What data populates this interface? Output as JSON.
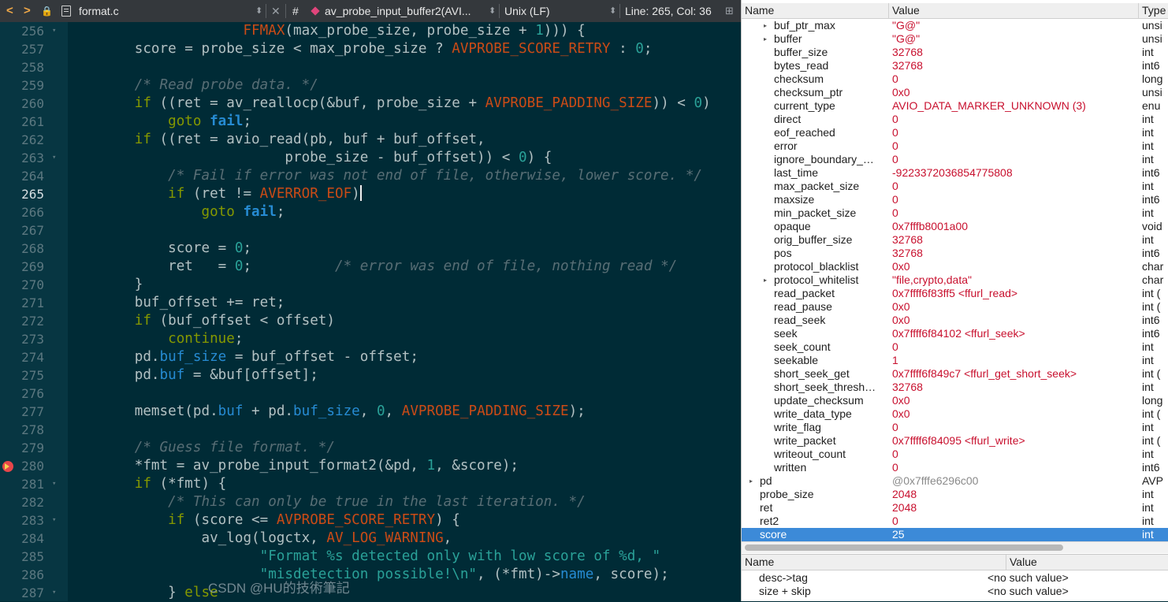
{
  "toolbar": {
    "back": "<",
    "forward": ">",
    "file_name": "format.c",
    "close": "✕",
    "hash": "#",
    "function": "av_probe_input_buffer2(AVI...",
    "line_ending": "Unix (LF)",
    "position": "Line: 265, Col: 36"
  },
  "editor": {
    "current_line": 265,
    "breakpoint_line": 280,
    "lines": [
      {
        "n": 256,
        "fold": true,
        "t": [
          [
            "                     ",
            ""
          ],
          [
            "FFMAX",
            "mac"
          ],
          [
            "(max_probe_size, probe_size + ",
            ""
          ],
          [
            "1",
            "num"
          ],
          [
            "))) {",
            ""
          ]
        ]
      },
      {
        "n": 257,
        "t": [
          [
            "        score = probe_size < max_probe_size ? ",
            ""
          ],
          [
            "AVPROBE_SCORE_RETRY",
            "mac"
          ],
          [
            " : ",
            ""
          ],
          [
            "0",
            "num"
          ],
          [
            ";",
            ""
          ]
        ]
      },
      {
        "n": 258,
        "t": []
      },
      {
        "n": 259,
        "t": [
          [
            "        ",
            ""
          ],
          [
            "/* Read probe data. */",
            "cmt"
          ]
        ]
      },
      {
        "n": 260,
        "t": [
          [
            "        ",
            ""
          ],
          [
            "if",
            "kw"
          ],
          [
            " ((ret = av_reallocp(&buf, probe_size + ",
            ""
          ],
          [
            "AVPROBE_PADDING_SIZE",
            "mac"
          ],
          [
            ")) < ",
            ""
          ],
          [
            "0",
            "num"
          ],
          [
            ")",
            ""
          ]
        ]
      },
      {
        "n": 261,
        "t": [
          [
            "            ",
            ""
          ],
          [
            "goto",
            "kw"
          ],
          [
            " ",
            ""
          ],
          [
            "fail",
            "kwb"
          ],
          [
            ";",
            ""
          ]
        ]
      },
      {
        "n": 262,
        "t": [
          [
            "        ",
            ""
          ],
          [
            "if",
            "kw"
          ],
          [
            " ((ret = avio_read(pb, buf + buf_offset,",
            ""
          ]
        ]
      },
      {
        "n": 263,
        "fold": true,
        "t": [
          [
            "                          probe_size - buf_offset)) < ",
            ""
          ],
          [
            "0",
            "num"
          ],
          [
            ") {",
            ""
          ]
        ]
      },
      {
        "n": 264,
        "t": [
          [
            "            ",
            ""
          ],
          [
            "/* Fail if error was not end of file, otherwise, lower score. */",
            "cmt"
          ]
        ]
      },
      {
        "n": 265,
        "caret": true,
        "t": [
          [
            "            ",
            ""
          ],
          [
            "if",
            "kw"
          ],
          [
            " (ret != ",
            ""
          ],
          [
            "AVERROR_EOF",
            "mac"
          ],
          [
            ")",
            ""
          ]
        ]
      },
      {
        "n": 266,
        "t": [
          [
            "                ",
            ""
          ],
          [
            "goto",
            "kw"
          ],
          [
            " ",
            ""
          ],
          [
            "fail",
            "kwb"
          ],
          [
            ";",
            ""
          ]
        ]
      },
      {
        "n": 267,
        "t": []
      },
      {
        "n": 268,
        "t": [
          [
            "            score = ",
            ""
          ],
          [
            "0",
            "num"
          ],
          [
            ";",
            ""
          ]
        ]
      },
      {
        "n": 269,
        "t": [
          [
            "            ret   = ",
            ""
          ],
          [
            "0",
            "num"
          ],
          [
            ";          ",
            ""
          ],
          [
            "/* error was end of file, nothing read */",
            "cmt"
          ]
        ]
      },
      {
        "n": 270,
        "t": [
          [
            "        }",
            ""
          ]
        ]
      },
      {
        "n": 271,
        "t": [
          [
            "        buf_offset += ret;",
            ""
          ]
        ]
      },
      {
        "n": 272,
        "t": [
          [
            "        ",
            ""
          ],
          [
            "if",
            "kw"
          ],
          [
            " (buf_offset < offset)",
            ""
          ]
        ]
      },
      {
        "n": 273,
        "t": [
          [
            "            ",
            ""
          ],
          [
            "continue",
            "kw"
          ],
          [
            ";",
            ""
          ]
        ]
      },
      {
        "n": 274,
        "t": [
          [
            "        pd.",
            ""
          ],
          [
            "buf_size",
            "fld"
          ],
          [
            " = buf_offset - offset;",
            ""
          ]
        ]
      },
      {
        "n": 275,
        "t": [
          [
            "        pd.",
            ""
          ],
          [
            "buf",
            "fld"
          ],
          [
            " = &buf[offset];",
            ""
          ]
        ]
      },
      {
        "n": 276,
        "t": []
      },
      {
        "n": 277,
        "t": [
          [
            "        memset(pd.",
            ""
          ],
          [
            "buf",
            "fld"
          ],
          [
            " + pd.",
            ""
          ],
          [
            "buf_size",
            "fld"
          ],
          [
            ", ",
            ""
          ],
          [
            "0",
            "num"
          ],
          [
            ", ",
            ""
          ],
          [
            "AVPROBE_PADDING_SIZE",
            "mac"
          ],
          [
            ");",
            ""
          ]
        ]
      },
      {
        "n": 278,
        "t": []
      },
      {
        "n": 279,
        "t": [
          [
            "        ",
            ""
          ],
          [
            "/* Guess file format. */",
            "cmt"
          ]
        ]
      },
      {
        "n": 280,
        "t": [
          [
            "        *fmt = av_probe_input_format2(&pd, ",
            ""
          ],
          [
            "1",
            "num"
          ],
          [
            ", &score);",
            ""
          ]
        ]
      },
      {
        "n": 281,
        "fold": true,
        "t": [
          [
            "        ",
            ""
          ],
          [
            "if",
            "kw"
          ],
          [
            " (*fmt) {",
            ""
          ]
        ]
      },
      {
        "n": 282,
        "t": [
          [
            "            ",
            ""
          ],
          [
            "/* This can only be true in the last iteration. */",
            "cmt"
          ]
        ]
      },
      {
        "n": 283,
        "fold": true,
        "t": [
          [
            "            ",
            ""
          ],
          [
            "if",
            "kw"
          ],
          [
            " (score <= ",
            ""
          ],
          [
            "AVPROBE_SCORE_RETRY",
            "mac"
          ],
          [
            ") {",
            ""
          ]
        ]
      },
      {
        "n": 284,
        "t": [
          [
            "                av_log(logctx, ",
            ""
          ],
          [
            "AV_LOG_WARNING",
            "mac"
          ],
          [
            ",",
            ""
          ]
        ]
      },
      {
        "n": 285,
        "t": [
          [
            "                       ",
            ""
          ],
          [
            "\"Format %s detected only with low score of %d, \"",
            "str"
          ]
        ]
      },
      {
        "n": 286,
        "t": [
          [
            "                       ",
            ""
          ],
          [
            "\"misdetection possible!\\n\"",
            "str"
          ],
          [
            ", (*fmt)->",
            ""
          ],
          [
            "name",
            "fld"
          ],
          [
            ", score);",
            ""
          ]
        ]
      },
      {
        "n": 287,
        "fold": true,
        "t": [
          [
            "            } ",
            ""
          ],
          [
            "else",
            "kw"
          ]
        ]
      }
    ]
  },
  "locals": {
    "headers": {
      "name": "Name",
      "value": "Value",
      "type": "Type"
    },
    "rows": [
      {
        "indent": 1,
        "exp": true,
        "name": "buf_ptr_max",
        "value": "\"G@\"",
        "type": "unsi"
      },
      {
        "indent": 1,
        "exp": true,
        "name": "buffer",
        "value": "\"G@\"",
        "type": "unsi"
      },
      {
        "indent": 1,
        "name": "buffer_size",
        "value": "32768",
        "type": "int"
      },
      {
        "indent": 1,
        "name": "bytes_read",
        "value": "32768",
        "type": "int6"
      },
      {
        "indent": 1,
        "name": "checksum",
        "value": "0",
        "type": "long"
      },
      {
        "indent": 1,
        "name": "checksum_ptr",
        "value": "0x0",
        "type": "unsi"
      },
      {
        "indent": 1,
        "name": "current_type",
        "value": "AVIO_DATA_MARKER_UNKNOWN (3)",
        "type": "enu"
      },
      {
        "indent": 1,
        "name": "direct",
        "value": "0",
        "type": "int"
      },
      {
        "indent": 1,
        "name": "eof_reached",
        "value": "0",
        "type": "int"
      },
      {
        "indent": 1,
        "name": "error",
        "value": "0",
        "type": "int"
      },
      {
        "indent": 1,
        "name": "ignore_boundary_…",
        "value": "0",
        "type": "int"
      },
      {
        "indent": 1,
        "name": "last_time",
        "value": "-9223372036854775808",
        "type": "int6"
      },
      {
        "indent": 1,
        "name": "max_packet_size",
        "value": "0",
        "type": "int"
      },
      {
        "indent": 1,
        "name": "maxsize",
        "value": "0",
        "type": "int6"
      },
      {
        "indent": 1,
        "name": "min_packet_size",
        "value": "0",
        "type": "int"
      },
      {
        "indent": 1,
        "name": "opaque",
        "value": "0x7fffb8001a00",
        "type": "void"
      },
      {
        "indent": 1,
        "name": "orig_buffer_size",
        "value": "32768",
        "type": "int"
      },
      {
        "indent": 1,
        "name": "pos",
        "value": "32768",
        "type": "int6"
      },
      {
        "indent": 1,
        "name": "protocol_blacklist",
        "value": "0x0",
        "type": "char"
      },
      {
        "indent": 1,
        "exp": true,
        "name": "protocol_whitelist",
        "value": "\"file,crypto,data\"",
        "type": "char"
      },
      {
        "indent": 1,
        "name": "read_packet",
        "value": "0x7ffff6f83ff5 <ffurl_read>",
        "type": "int ("
      },
      {
        "indent": 1,
        "name": "read_pause",
        "value": "0x0",
        "type": "int ("
      },
      {
        "indent": 1,
        "name": "read_seek",
        "value": "0x0",
        "type": "int6"
      },
      {
        "indent": 1,
        "name": "seek",
        "value": "0x7ffff6f84102 <ffurl_seek>",
        "type": "int6"
      },
      {
        "indent": 1,
        "name": "seek_count",
        "value": "0",
        "type": "int"
      },
      {
        "indent": 1,
        "name": "seekable",
        "value": "1",
        "type": "int"
      },
      {
        "indent": 1,
        "name": "short_seek_get",
        "value": "0x7ffff6f849c7 <ffurl_get_short_seek>",
        "type": "int ("
      },
      {
        "indent": 1,
        "name": "short_seek_thresh…",
        "value": "32768",
        "type": "int"
      },
      {
        "indent": 1,
        "name": "update_checksum",
        "value": "0x0",
        "type": "long"
      },
      {
        "indent": 1,
        "name": "write_data_type",
        "value": "0x0",
        "type": "int ("
      },
      {
        "indent": 1,
        "name": "write_flag",
        "value": "0",
        "type": "int"
      },
      {
        "indent": 1,
        "name": "write_packet",
        "value": "0x7ffff6f84095 <ffurl_write>",
        "type": "int ("
      },
      {
        "indent": 1,
        "name": "writeout_count",
        "value": "0",
        "type": "int"
      },
      {
        "indent": 1,
        "name": "written",
        "value": "0",
        "type": "int6"
      },
      {
        "indent": 0,
        "exp": true,
        "name": "pd",
        "value": "@0x7fffe6296c00",
        "gray": true,
        "type": "AVP"
      },
      {
        "indent": 0,
        "name": "probe_size",
        "value": "2048",
        "type": "int"
      },
      {
        "indent": 0,
        "name": "ret",
        "value": "2048",
        "type": "int"
      },
      {
        "indent": 0,
        "name": "ret2",
        "value": "0",
        "type": "int"
      },
      {
        "indent": 0,
        "name": "score",
        "value": "25",
        "type": "int",
        "selected": true
      }
    ]
  },
  "expressions": {
    "headers": {
      "name": "Name",
      "value": "Value"
    },
    "rows": [
      {
        "name": "desc->tag",
        "value": "<no such value>"
      },
      {
        "name": "size + skip",
        "value": "<no such value>"
      }
    ]
  },
  "watermark": "CSDN @HU的技術筆記"
}
